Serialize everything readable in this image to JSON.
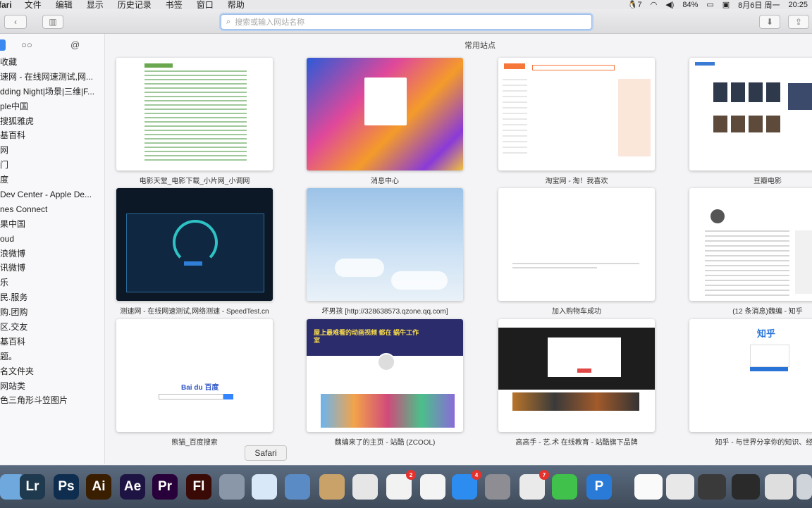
{
  "menubar": {
    "app_name": "fari",
    "items": [
      "文件",
      "编辑",
      "显示",
      "历史记录",
      "书签",
      "窗口",
      "帮助"
    ],
    "status": {
      "qq_count": "7",
      "battery": "84%",
      "date": "8月6日 周一",
      "time": "20:25"
    }
  },
  "toolbar": {
    "address_placeholder": "搜索或输入网站名称"
  },
  "sidebar": {
    "tab_readinglist": "○○",
    "tab_shared": "@",
    "items": [
      "收藏",
      "速网 - 在线网速测试,网...",
      "dding Night|场景|三维|F...",
      "ple中国",
      "搜狐雅虎",
      "基百科",
      "网",
      "门",
      "度",
      " Dev Center - Apple De...",
      "nes Connect",
      "果中国",
      "oud",
      "浪微博",
      "讯微博",
      "乐",
      "民.服务",
      "购.团购",
      "区.交友",
      "基百科",
      "题。",
      "名文件夹",
      "网站类",
      "色三角形斗笠图片"
    ]
  },
  "main": {
    "section_title": "常用站点",
    "tiles": [
      {
        "label": "电影天堂_电影下载_小片网_小调网",
        "theme": "list"
      },
      {
        "label": "消息中心",
        "theme": "colorful"
      },
      {
        "label": "淘宝网 - 淘！我喜欢",
        "theme": "taobao"
      },
      {
        "label": "豆瓣电影",
        "theme": "douban"
      },
      {
        "label": "测速网 - 在线网速测试,网络测速 - SpeedTest.cn",
        "theme": "speed"
      },
      {
        "label": "坏男孩 [http://328638573.qzone.qq.com]",
        "theme": "sky"
      },
      {
        "label": "加入购物车成功",
        "theme": "blank"
      },
      {
        "label": "(12 条消息)魏编 - 知乎",
        "theme": "zhihu-profile"
      },
      {
        "label": "熊猫_百度搜索",
        "theme": "baidu"
      },
      {
        "label": "魏编来了的主页 - 站酷 (ZCOOL)",
        "theme": "zcool"
      },
      {
        "label": "高高手 - 艺.术 在线教育 - 站酷旗下品牌",
        "theme": "gaogaoshou"
      },
      {
        "label": "知乎 - 与世界分享你的知识、经验",
        "theme": "zhihu"
      }
    ],
    "thumb_text": {
      "baidu_logo": "Bai du 百度",
      "zhihu_logo": "知乎",
      "zcool_banner": "屋上最难看的动画视频 都在 蜗牛工作室"
    }
  },
  "tooltip": "Safari",
  "dock": {
    "items": [
      {
        "name": "finder",
        "label": "",
        "color": "#6fa8dc"
      },
      {
        "name": "lightroom",
        "label": "Lr",
        "color": "#1f3a4e"
      },
      {
        "name": "photoshop",
        "label": "Ps",
        "color": "#0f2e4f"
      },
      {
        "name": "illustrator",
        "label": "Ai",
        "color": "#3a1e00"
      },
      {
        "name": "after-effects",
        "label": "Ae",
        "color": "#1e1443"
      },
      {
        "name": "premiere",
        "label": "Pr",
        "color": "#28003a"
      },
      {
        "name": "flash",
        "label": "Fl",
        "color": "#3a0a06"
      },
      {
        "name": "launchpad",
        "label": "",
        "color": "#8a97a8"
      },
      {
        "name": "safari",
        "label": "",
        "color": "#d8e8f8"
      },
      {
        "name": "preview",
        "label": "",
        "color": "#5b8bc4"
      },
      {
        "name": "notes",
        "label": "",
        "color": "#c9a26a"
      },
      {
        "name": "photo-viewer",
        "label": "",
        "color": "#e6e6e6"
      },
      {
        "name": "photos",
        "label": "",
        "color": "#f2f2f2",
        "badge": "2"
      },
      {
        "name": "itunes",
        "label": "",
        "color": "#f4f4f4"
      },
      {
        "name": "app-store",
        "label": "",
        "color": "#2d8cf0",
        "badge": "4"
      },
      {
        "name": "system-preferences",
        "label": "",
        "color": "#8d8d93"
      },
      {
        "name": "qq",
        "label": "",
        "color": "#eaeaea",
        "badge": "7"
      },
      {
        "name": "wechat",
        "label": "",
        "color": "#3fc14b"
      },
      {
        "name": "pages-p",
        "label": "P",
        "color": "#2a7bd8"
      }
    ]
  }
}
